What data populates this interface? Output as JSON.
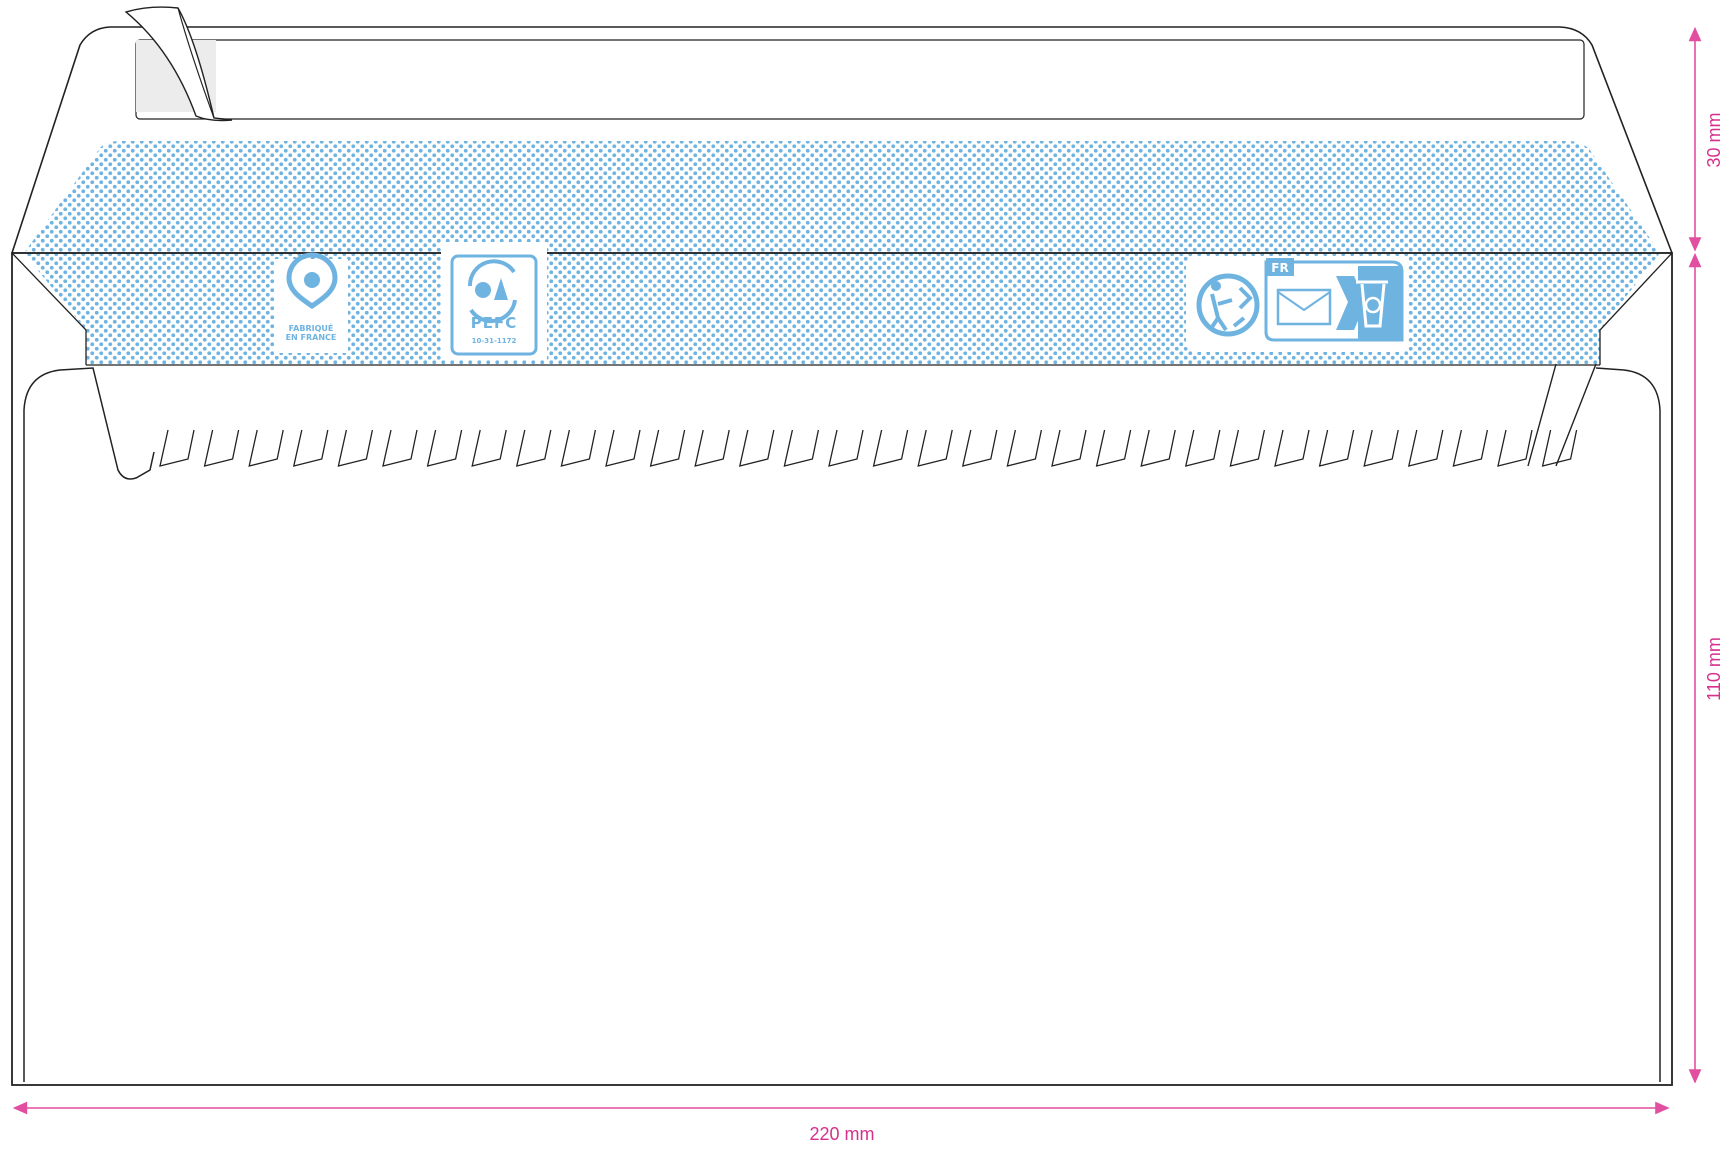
{
  "dimensions": {
    "width_label": "220 mm",
    "flap_height_label": "30 mm",
    "body_height_label": "110 mm"
  },
  "logos": {
    "fabrique": {
      "line1": "FABRIQUÉ",
      "line2": "EN FRANCE"
    },
    "pefc": {
      "name": "PEFC",
      "code": "10-31-1172"
    },
    "triman": {
      "country": "FR"
    }
  },
  "colors": {
    "dimension": "#d6308d",
    "tint": "#6fb4e0",
    "outline": "#222222",
    "logo": "#6fb4e0"
  }
}
